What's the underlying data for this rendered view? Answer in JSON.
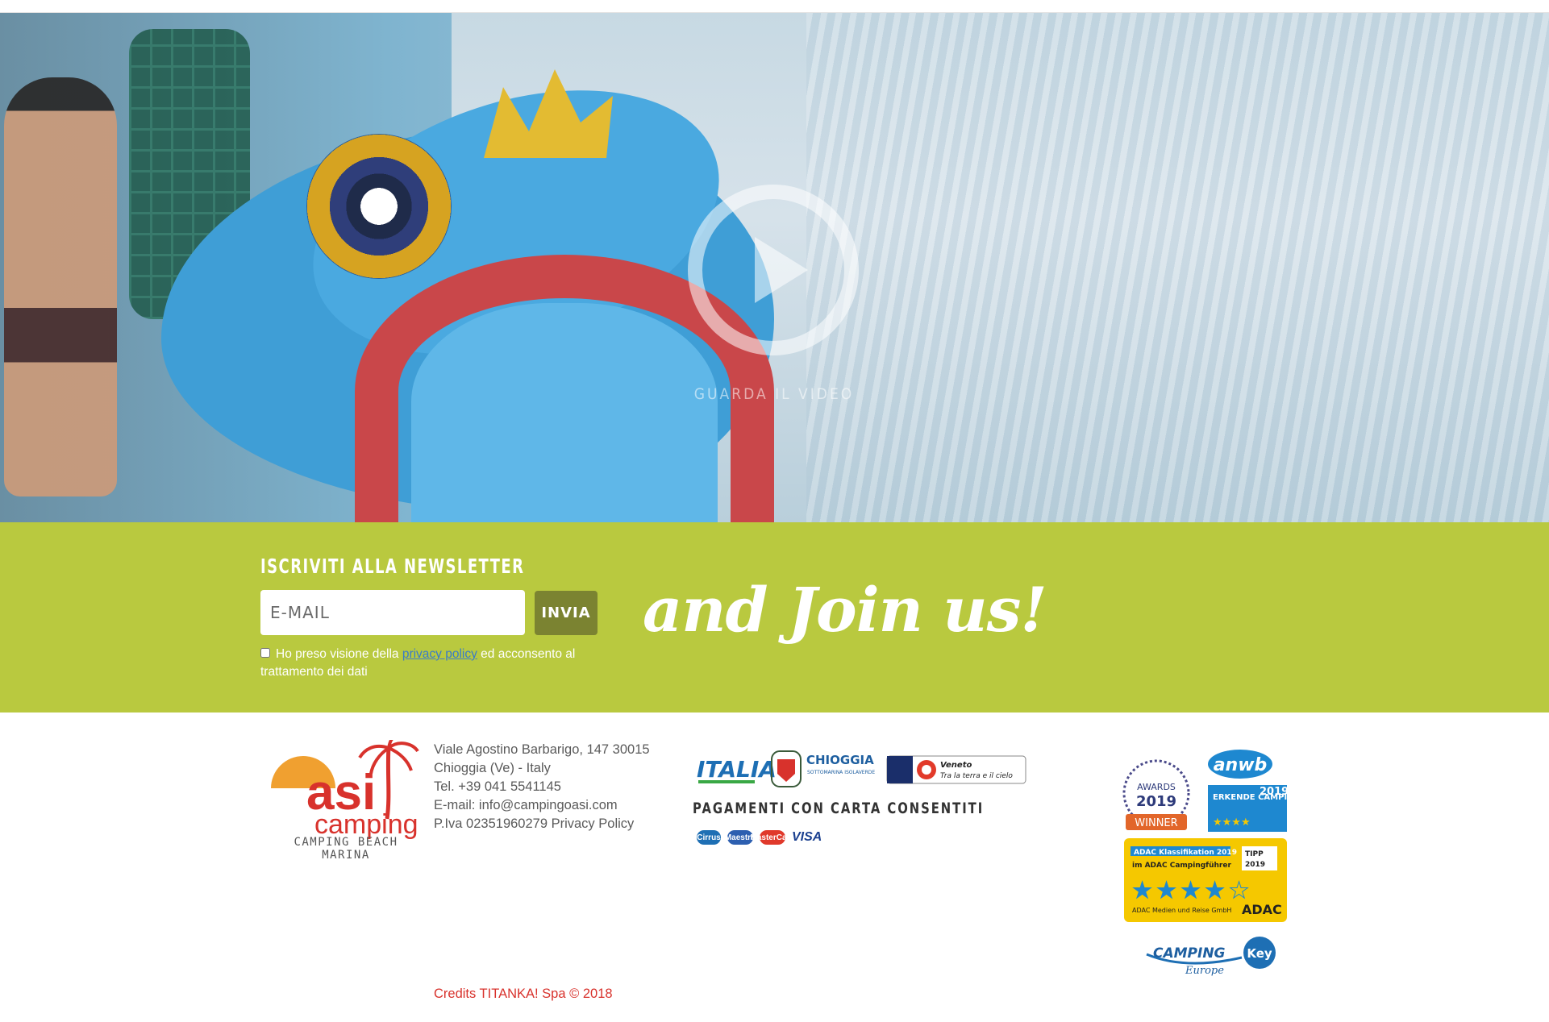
{
  "hero": {
    "play_label": "GUARDA IL VIDEO"
  },
  "newsletter": {
    "title": "ISCRIVITI ALLA NEWSLETTER",
    "email_placeholder": "E-MAIL",
    "email_value": "",
    "submit_label": "INVIA",
    "consent_prefix": "Ho preso visione della",
    "consent_link": "privacy policy",
    "consent_suffix": "ed acconsento al trattamento dei dati",
    "slogan": "and Join us!"
  },
  "footer": {
    "logo": {
      "main": "asi",
      "sub": "camping",
      "tagline": "CAMPING BEACH MARINA"
    },
    "address": [
      "Viale Agostino Barbarigo, 147 30015",
      "Chioggia (Ve) - Italy",
      "Tel. +39 041 5541145",
      "E-mail: info@campingoasi.com",
      "P.Iva 02351960279 Privacy Policy"
    ],
    "partners": {
      "italia": "ITALIA",
      "chioggia": "CHIOGGIA",
      "chioggia_sub": "SOTTOMARINA ISOLAVERDE",
      "veneto": "Veneto",
      "veneto_sub": "Tra la terra e il cielo"
    },
    "payments_title": "PAGAMENTI CON CARTA CONSENTITI",
    "cards": [
      "Cirrus",
      "Maestro",
      "MasterCard",
      "VISA"
    ],
    "badges": {
      "awards_text": "AWARDS",
      "awards_year": "2019",
      "awards_winner": "WINNER",
      "anwb": "anwb",
      "anwb_erkend": "ERKENDE CAMPING",
      "anwb_year": "2019",
      "adac_line1": "ADAC Klassifikation 2019",
      "adac_line2": "im ADAC Campingführer",
      "adac_tipp": "TIPP 2019",
      "adac_footer": "ADAC Medien und Reise GmbH",
      "adac_brand": "ADAC",
      "adac_rating": 4,
      "campingkey": "CAMPING",
      "campingkey_key": "Key",
      "campingkey_sub": "Europe"
    },
    "credits": "Credits TITANKA! Spa © 2018"
  },
  "colors": {
    "newsletter_bg": "#b9c93f",
    "button_bg": "#7b8331",
    "logo_red": "#d8322c",
    "logo_orange": "#f0a030",
    "credits": "#d8322c"
  }
}
